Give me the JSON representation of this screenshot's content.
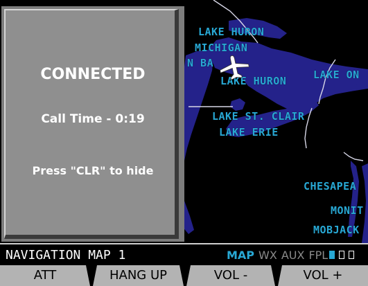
{
  "popup": {
    "title": "CONNECTED",
    "call_time": "Call Time - 0:19",
    "hint": "Press \"CLR\" to hide"
  },
  "map": {
    "labels": {
      "lake_huron_top": "LAKE HURON",
      "michigan": "MICHIGAN",
      "n_ba": "N BA",
      "lake_huron_mid": "LAKE HURON",
      "lake_on": "LAKE ON",
      "lake_st_clair": "LAKE ST. CLAIR",
      "lake_erie": "LAKE ERIE",
      "chesapea": "CHESAPEA",
      "monit": "MONIT",
      "mobjack": "MOBJACK"
    },
    "colors": {
      "water": "#24228a",
      "land": "#000000",
      "label": "#28a8d4",
      "border": "#d8d8e8",
      "aircraft": "#ffffff"
    }
  },
  "status_bar": {
    "page_title": "NAVIGATION MAP 1",
    "groups": [
      {
        "label": "MAP",
        "active": true,
        "color": "#28a8d4"
      },
      {
        "label": "WX",
        "active": false,
        "color": "#8a8a8a"
      },
      {
        "label": "AUX",
        "active": false,
        "color": "#8a8a8a"
      },
      {
        "label": "FPL",
        "active": false,
        "color": "#8a8a8a"
      }
    ],
    "page_indicator": {
      "current": 1,
      "total": 3
    }
  },
  "softkeys": [
    {
      "label": "ATT"
    },
    {
      "label": "HANG UP"
    },
    {
      "label": "VOL -"
    },
    {
      "label": "VOL +"
    }
  ]
}
